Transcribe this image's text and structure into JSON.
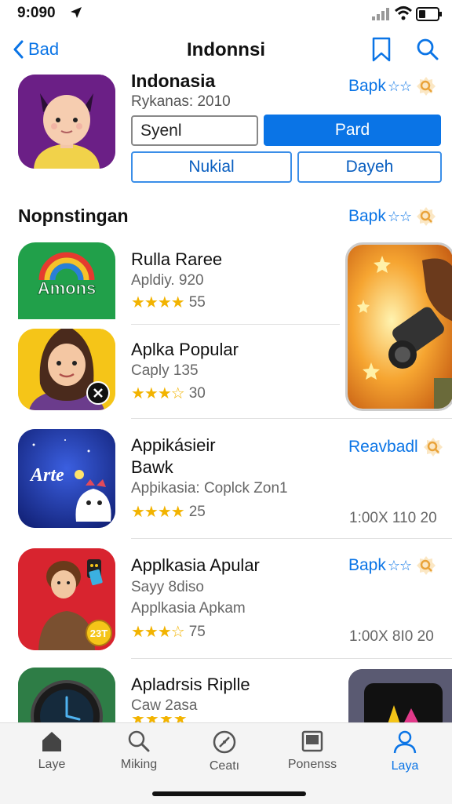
{
  "status_bar": {
    "time": "9:090"
  },
  "nav": {
    "back_label": "Bad",
    "title": "Indonnsi"
  },
  "hero": {
    "name": "Indonasia",
    "subtitle": "Rykanas: 2010",
    "rate_label": "Bapk",
    "rate_stars": "☆☆",
    "input_value": "Syenl",
    "primary_button": "Pard",
    "button_left": "Nukial",
    "button_right": "Dayeh"
  },
  "section": {
    "title": "Nopnstingan",
    "rate_label": "Bapk",
    "rate_stars": "☆☆"
  },
  "apps": [
    {
      "name": "Rulla Raree",
      "subtitle": "Apldiy. 920",
      "stars": "★★★★",
      "count": "55",
      "icon_text": "Amons"
    },
    {
      "name": "Aplka Popular",
      "subtitle": "Caply 135",
      "stars": "★★★☆",
      "count": "30"
    },
    {
      "name_line1": "Appikásieir",
      "name_line2": "Bawk",
      "subtitle": "Apþikasia: Coplck Zon1",
      "stars": "★★★★",
      "count": "25",
      "action": "Reavbadl",
      "meta": "1:00X 110  20",
      "icon_text": "Arte"
    },
    {
      "name": "Applkasia Apular",
      "subtitle": "Sayy 8diso",
      "subtitle2": "Applkasia Apkam",
      "stars": "★★★☆",
      "count": "75",
      "action_label": "Bapk",
      "action_stars": "☆☆",
      "meta": "1:00X 8I0  20",
      "icon_text": "23T"
    },
    {
      "name": "Apladrsis Riplle",
      "subtitle": "Caw 2asa"
    }
  ],
  "tabs": [
    {
      "label": "Laye",
      "icon": "home-icon"
    },
    {
      "label": "Miking",
      "icon": "search-icon"
    },
    {
      "label": "Ceatı",
      "icon": "compass-icon"
    },
    {
      "label": "Ponenss",
      "icon": "book-icon"
    },
    {
      "label": "Laya",
      "icon": "person-icon",
      "active": true
    }
  ],
  "colors": {
    "accent": "#0a74e6",
    "star": "#f2b300",
    "badge": "#e9a33a"
  }
}
